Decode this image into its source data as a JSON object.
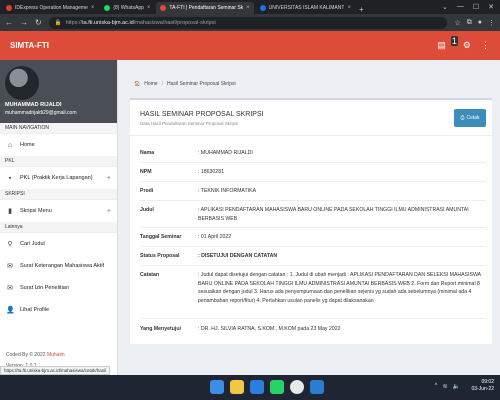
{
  "browser": {
    "tabs": [
      {
        "title": "IDExpress Operation Manageme",
        "color": "#e53935",
        "active": false
      },
      {
        "title": "(8) WhatsApp",
        "color": "#25d366",
        "active": false
      },
      {
        "title": "TA-FTI | Pendaftaran Seminar Sk",
        "color": "#dd4b39",
        "active": true
      },
      {
        "title": "UNIVERSITAS ISLAM KALIMANT",
        "color": "#1a73e8",
        "active": false
      }
    ],
    "url_prefix": "https://",
    "url_main": "ta.fti.uniska-bjm.ac.id",
    "url_path": "/mahasiswa/hasil/proposal-skripsi"
  },
  "app": {
    "brand": "SIMTA-FTI",
    "notif_count": "1"
  },
  "sidebar": {
    "user_name": "MUHAMMAD RIJALDI",
    "user_email": "muhammadrijaldi29@gmail.com",
    "sections": {
      "main": "MAIN NAVIGATION",
      "pkl": "PKL",
      "skripsi": "SKRIPSI",
      "lainnya": "Lainnya"
    },
    "items": {
      "home": "Home",
      "pkl": "PKL (Praktik Kerja Lapangan)",
      "skripsi": "Skripsi Menu",
      "cari": "Cari Judul",
      "surat_aktif": "Surat Keterangan Mahasiswa Aktif",
      "surat_izin": "Surat Izin Penelitian",
      "profil": "Lihat Profile"
    },
    "coded_prefix": "Coded By © 2022 ",
    "coded_link": "Muhaim",
    "version": "Version: 1.0.1"
  },
  "status_url": "https://ta.fti.uniska-bjm.ac.id/mahasiswa/cetak/hasil",
  "breadcrumb": {
    "home": "Home",
    "current": "Hasil Seminar Proposal Skripsi"
  },
  "box": {
    "title": "HASIL SEMINAR PROPOSAL SKRIPSI",
    "subtitle": "Data Hasil Pendaftaran Seminar Proposal Skripsi",
    "print_label": "Cetak"
  },
  "details": {
    "nama": {
      "label": "Nama",
      "value": ": MUHAMMAD RIJALDI"
    },
    "npm": {
      "label": "NPM",
      "value": ": 18630281"
    },
    "prodi": {
      "label": "Prodi",
      "value": ": TEKNIK INFORMATIKA"
    },
    "judul": {
      "label": "Judul",
      "value": ": APLIKASI PENDAFTARAN MAHASISWA BARU ONLINE PADA SEKOLAH TINGGI ILMU ADMINISTRASI AMUNTAI BERBASIS WEB"
    },
    "tanggal": {
      "label": "Tanggal Seminar",
      "value": ": 01 April 2022"
    },
    "status": {
      "label": "Status Proposal",
      "value": ": DISETUJUI DENGAN CATATAN"
    },
    "catatan": {
      "label": "Catatan",
      "value": ": Judul dapat disetujui dengan catatan : 1. Judul di ubah menjadi : APLIKASI PENDAFTARAN DAN SELEKSI MAHASISWA BARU ONLINE PADA SEKOLAH TINGGI ILMU ADMINISTRASI AMUNTAI BERBASIS WEB 2. Form dan Report minimal 8 sesuaikan dengan judul 3. Harus ada penyempurnaan dan penelitian sejenis yg sudah ada sebelumnya (minimal ada 4 penambahan report/fitur) 4. Pertahkan usulan panelis yg dapat dilaksanakan"
    },
    "penyetuju": {
      "label": "Yang Menyetujui",
      "value": ": DR. HJ. SILVIA RATNA, S.KOM., M.KOM pada 23 May 2022"
    }
  },
  "taskbar": {
    "time": "09:02",
    "date": "03-Jun-22"
  }
}
